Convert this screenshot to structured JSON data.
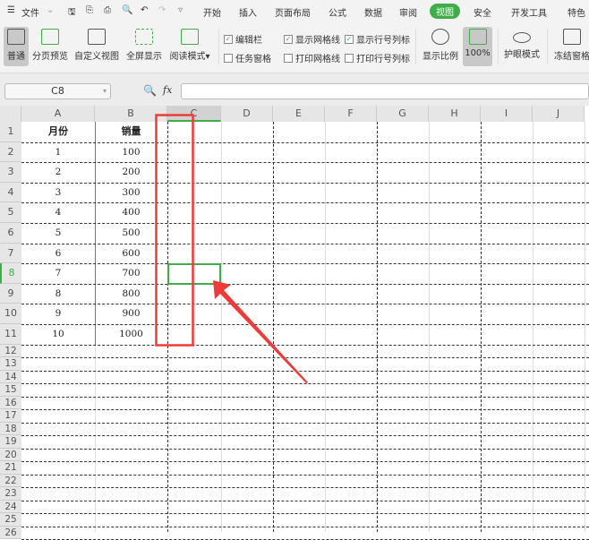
{
  "menu": {
    "file": "文件",
    "tabs": [
      "开始",
      "插入",
      "页面布局",
      "公式",
      "数据",
      "审阅",
      "视图",
      "安全",
      "开发工具",
      "特色"
    ],
    "active_tab": "视图"
  },
  "ribbon": {
    "buttons": [
      "普通",
      "分页预览",
      "自定义视图",
      "全屏显示",
      "阅读模式",
      "显示比例",
      "100%",
      "护眼模式",
      "冻结窗格"
    ],
    "checks": [
      {
        "label": "编辑栏",
        "checked": true
      },
      {
        "label": "任务窗格",
        "checked": false
      },
      {
        "label": "显示网格线",
        "checked": true
      },
      {
        "label": "打印网格线",
        "checked": false
      },
      {
        "label": "显示行号列标",
        "checked": true
      },
      {
        "label": "打印行号列标",
        "checked": false
      }
    ]
  },
  "formula_bar": {
    "name_box": "C8",
    "fx": "fx",
    "formula": ""
  },
  "sheet": {
    "columns": [
      "A",
      "B",
      "C",
      "D",
      "E",
      "F",
      "G",
      "H",
      "I",
      "J"
    ],
    "row_count": 26,
    "header": [
      "月份",
      "销量"
    ],
    "rows": [
      [
        "1",
        "100"
      ],
      [
        "2",
        "200"
      ],
      [
        "3",
        "300"
      ],
      [
        "4",
        "400"
      ],
      [
        "5",
        "500"
      ],
      [
        "6",
        "600"
      ],
      [
        "7",
        "700"
      ],
      [
        "8",
        "800"
      ],
      [
        "9",
        "900"
      ],
      [
        "10",
        "1000"
      ]
    ],
    "selected_cell": "C8"
  },
  "colors": {
    "accent": "#3fae49",
    "annotation": "#f03a3a"
  }
}
